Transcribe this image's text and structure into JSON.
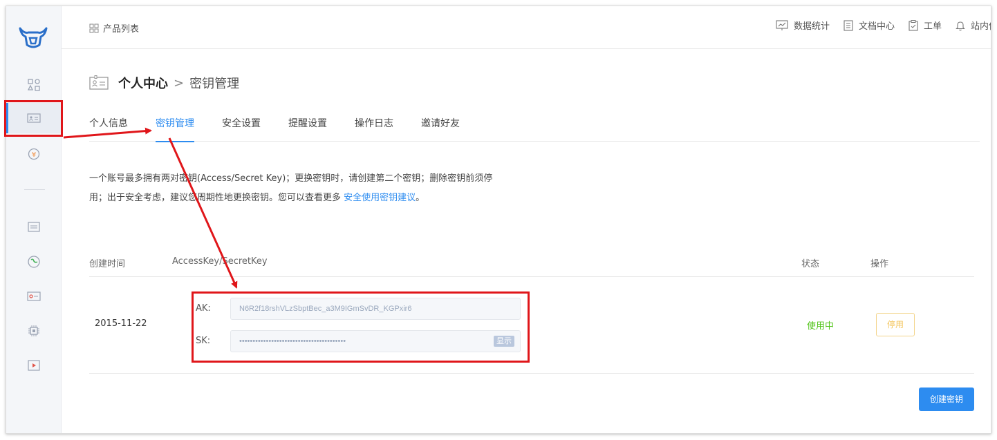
{
  "topbar": {
    "product_list": "产品列表",
    "stats": "数据统计",
    "docs": "文档中心",
    "ticket": "工单",
    "messages": "站内信"
  },
  "breadcrumb": {
    "title": "个人中心",
    "separator": ">",
    "current": "密钥管理"
  },
  "tabs": [
    {
      "label": "个人信息"
    },
    {
      "label": "密钥管理"
    },
    {
      "label": "安全设置"
    },
    {
      "label": "提醒设置"
    },
    {
      "label": "操作日志"
    },
    {
      "label": "邀请好友"
    }
  ],
  "description": {
    "line1": "一个账号最多拥有两对密钥(Access/Secret Key)；更换密钥时，请创建第二个密钥；删除密钥前须停",
    "line2": "用；出于安全考虑，建议您周期性地更换密钥。您可以查看更多 ",
    "link": "安全使用密钥建议",
    "tail": "。"
  },
  "table": {
    "headers": {
      "created": "创建时间",
      "key": "AccessKey/SecretKey",
      "status": "状态",
      "action": "操作"
    },
    "rows": [
      {
        "created": "2015-11-22",
        "ak_label": "AK:",
        "ak_value": "N6R2f18rshVLzSbptBec_a3M9IGmSvDR_KGPxir6",
        "sk_label": "SK:",
        "sk_value": "••••••••••••••••••••••••••••••••••••••••",
        "show_label": "显示",
        "status": "使用中",
        "action": "停用"
      }
    ]
  },
  "create_button": "创建密钥",
  "colors": {
    "accent": "#2d8cf0",
    "status_active": "#52c41a",
    "warning_outline": "#f3d48a",
    "annotation": "#e0161a"
  }
}
